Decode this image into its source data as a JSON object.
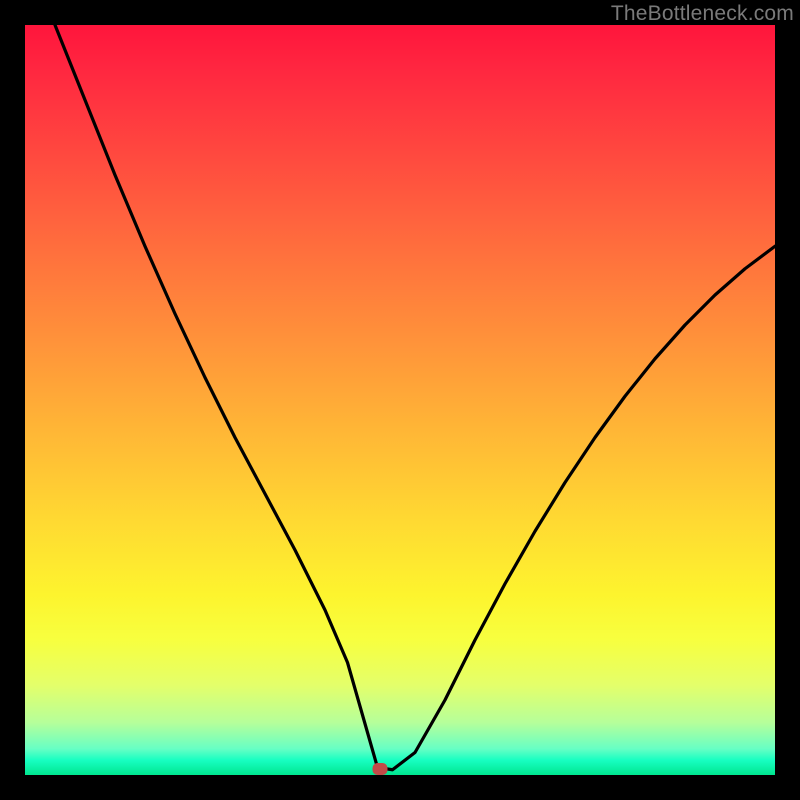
{
  "watermark": "TheBottleneck.com",
  "marker": {
    "x_pct": 47.3,
    "y_pct": 99.2
  },
  "chart_data": {
    "type": "line",
    "title": "",
    "xlabel": "",
    "ylabel": "",
    "xlim": [
      0,
      100
    ],
    "ylim": [
      0,
      100
    ],
    "series": [
      {
        "name": "curve",
        "x": [
          4,
          8,
          12,
          16,
          20,
          24,
          28,
          32,
          36,
          40,
          43,
          45,
          47,
          49,
          52,
          56,
          60,
          64,
          68,
          72,
          76,
          80,
          84,
          88,
          92,
          96,
          100
        ],
        "y": [
          100,
          90,
          80,
          70.5,
          61.5,
          53,
          45,
          37.5,
          30,
          22,
          15,
          8,
          1,
          0.7,
          3,
          10,
          18,
          25.5,
          32.5,
          39,
          45,
          50.5,
          55.5,
          60,
          64,
          67.5,
          70.5
        ]
      }
    ],
    "background_gradient": {
      "stops": [
        {
          "pct": 0,
          "color": "#ff153c"
        },
        {
          "pct": 50,
          "color": "#ffaa38"
        },
        {
          "pct": 80,
          "color": "#f7ff3f"
        },
        {
          "pct": 100,
          "color": "#00e68f"
        }
      ]
    }
  }
}
